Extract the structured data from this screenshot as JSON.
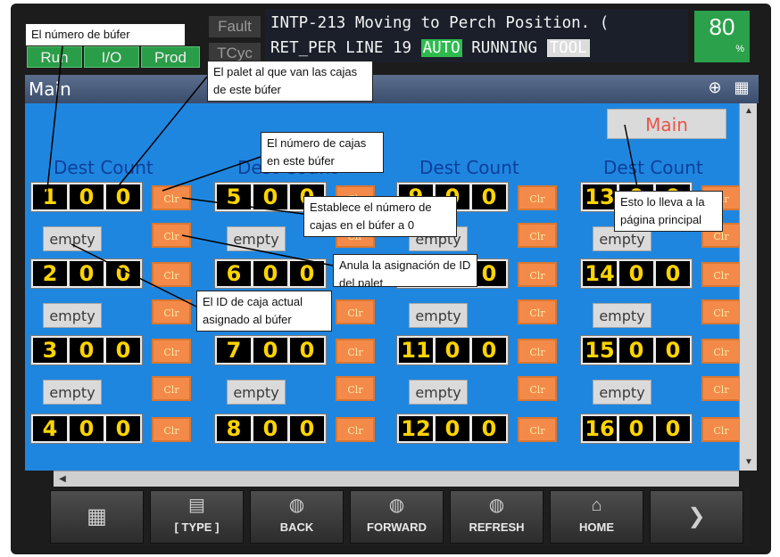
{
  "status": {
    "fault": "Fault",
    "tcyc": "TCyc",
    "run": "Run",
    "io": "I/O",
    "prod": "Prod"
  },
  "alarm": {
    "line1": "INTP-213 Moving to Perch Position.    (",
    "line2_prefix": "RET_PER LINE 19 ",
    "auto": "AUTO",
    "running": " RUNNING ",
    "tool": "TOOL"
  },
  "override": {
    "value": "80",
    "unit": "%"
  },
  "window": {
    "title": "Main"
  },
  "panel": {
    "main_button": "Main",
    "columns": [
      {
        "header": "Dest  Count",
        "rows": [
          {
            "dest": "1",
            "c1": "0",
            "c2": "0",
            "empty": "empty",
            "clr1": "Clr",
            "clr2": "Clr"
          },
          {
            "dest": "2",
            "c1": "0",
            "c2": "0",
            "empty": "empty",
            "clr1": "Clr",
            "clr2": "Clr"
          },
          {
            "dest": "3",
            "c1": "0",
            "c2": "0",
            "empty": "empty",
            "clr1": "Clr",
            "clr2": "Clr"
          },
          {
            "dest": "4",
            "c1": "0",
            "c2": "0",
            "empty": "",
            "clr1": "Clr",
            "clr2": ""
          }
        ]
      },
      {
        "header": "Dest  Count",
        "rows": [
          {
            "dest": "5",
            "c1": "0",
            "c2": "0",
            "empty": "empty",
            "clr1": "Clr",
            "clr2": "Clr"
          },
          {
            "dest": "6",
            "c1": "0",
            "c2": "0",
            "empty": "empty",
            "clr1": "Clr",
            "clr2": "Clr"
          },
          {
            "dest": "7",
            "c1": "0",
            "c2": "0",
            "empty": "empty",
            "clr1": "Clr",
            "clr2": "Clr"
          },
          {
            "dest": "8",
            "c1": "0",
            "c2": "0",
            "empty": "",
            "clr1": "Clr",
            "clr2": ""
          }
        ]
      },
      {
        "header": "Dest  Count",
        "rows": [
          {
            "dest": "9",
            "c1": "0",
            "c2": "0",
            "empty": "empty",
            "clr1": "Clr",
            "clr2": "Clr"
          },
          {
            "dest": "10",
            "c1": "0",
            "c2": "0",
            "empty": "empty",
            "clr1": "Clr",
            "clr2": "Clr"
          },
          {
            "dest": "11",
            "c1": "0",
            "c2": "0",
            "empty": "empty",
            "clr1": "Clr",
            "clr2": "Clr"
          },
          {
            "dest": "12",
            "c1": "0",
            "c2": "0",
            "empty": "",
            "clr1": "Clr",
            "clr2": ""
          }
        ]
      },
      {
        "header": "Dest  Count",
        "rows": [
          {
            "dest": "13",
            "c1": "0",
            "c2": "0",
            "empty": "empty",
            "clr1": "Clr",
            "clr2": "Clr"
          },
          {
            "dest": "14",
            "c1": "0",
            "c2": "0",
            "empty": "empty",
            "clr1": "Clr",
            "clr2": "Clr"
          },
          {
            "dest": "15",
            "c1": "0",
            "c2": "0",
            "empty": "empty",
            "clr1": "Clr",
            "clr2": "Clr"
          },
          {
            "dest": "16",
            "c1": "0",
            "c2": "0",
            "empty": "",
            "clr1": "Clr",
            "clr2": ""
          }
        ]
      }
    ]
  },
  "bottom_bar": [
    {
      "label": "",
      "icon": "grid-icon"
    },
    {
      "label": "[ TYPE ]",
      "icon": "type-icon"
    },
    {
      "label": "BACK",
      "icon": "globe-icon"
    },
    {
      "label": "FORWARD",
      "icon": "globe-icon"
    },
    {
      "label": "REFRESH",
      "icon": "globe-icon"
    },
    {
      "label": "HOME",
      "icon": "home-icon"
    },
    {
      "label": "",
      "icon": "chevron-right-icon"
    }
  ],
  "callouts": {
    "buffer_number": "El número de búfer",
    "pallet": "El palet al que van las cajas de este búfer",
    "box_count": "El número de cajas en este búfer",
    "clear_count": "Establece el número de cajas en el búfer a 0",
    "clear_pallet": "Anula la asignación de ID del palet",
    "box_id": "El ID de caja actual asignado al búfer",
    "main_page": "Esto lo lleva a la página principal"
  }
}
